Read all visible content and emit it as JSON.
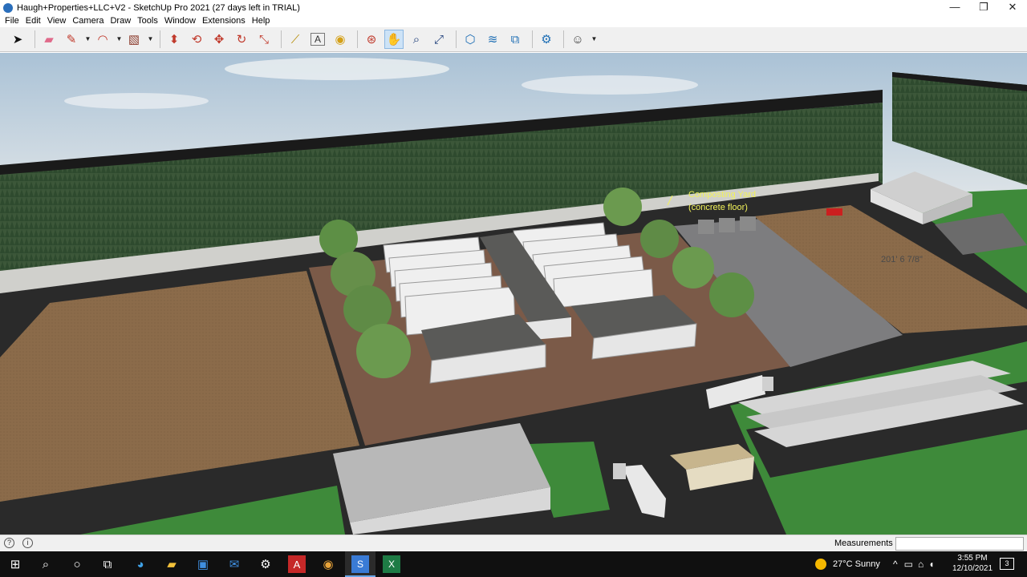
{
  "window": {
    "title": "Haugh+Properties+LLC+V2 - SketchUp Pro 2021 (27 days left in TRIAL)",
    "minimize": "—",
    "restore": "❐",
    "close": "✕"
  },
  "menu": [
    "File",
    "Edit",
    "View",
    "Camera",
    "Draw",
    "Tools",
    "Window",
    "Extensions",
    "Help"
  ],
  "toolbar": {
    "tools": [
      {
        "name": "select-tool",
        "icon": "arrow",
        "glyph": "➤"
      },
      {
        "name": "eraser-tool",
        "icon": "eraser",
        "glyph": "▰"
      },
      {
        "name": "line-tool",
        "icon": "pencil",
        "glyph": "✎"
      },
      {
        "name": "arc-tool",
        "icon": "arc",
        "glyph": "◠"
      },
      {
        "name": "shape-tool",
        "icon": "rectangle",
        "glyph": "▧"
      },
      {
        "name": "push-pull-tool",
        "icon": "push-pull",
        "glyph": "⬍"
      },
      {
        "name": "offset-tool",
        "icon": "offset",
        "glyph": "⟲"
      },
      {
        "name": "move-tool",
        "icon": "move",
        "glyph": "✥"
      },
      {
        "name": "rotate-tool",
        "icon": "rotate",
        "glyph": "↻"
      },
      {
        "name": "scale-tool",
        "icon": "scale",
        "glyph": "⤡"
      },
      {
        "name": "tape-measure-tool",
        "icon": "tape-measure",
        "glyph": "⟋"
      },
      {
        "name": "text-tool",
        "icon": "text",
        "glyph": "A"
      },
      {
        "name": "paint-bucket-tool",
        "icon": "paint-bucket",
        "glyph": "◉"
      },
      {
        "name": "orbit-tool",
        "icon": "orbit",
        "glyph": "⊛"
      },
      {
        "name": "pan-tool",
        "icon": "hand",
        "glyph": "✋"
      },
      {
        "name": "zoom-tool",
        "icon": "magnifier",
        "glyph": "⌕"
      },
      {
        "name": "zoom-extents-tool",
        "icon": "zoom-extents",
        "glyph": "⤢"
      },
      {
        "name": "warehouse-tool",
        "icon": "3d-warehouse",
        "glyph": "⬡"
      },
      {
        "name": "extension-warehouse-tool",
        "icon": "extension-warehouse",
        "glyph": "≋"
      },
      {
        "name": "layout-tool",
        "icon": "layout",
        "glyph": "⧉"
      },
      {
        "name": "extension-manager-tool",
        "icon": "extension-manager",
        "glyph": "⚙"
      },
      {
        "name": "account-tool",
        "icon": "user",
        "glyph": "☺"
      }
    ]
  },
  "scene": {
    "annotation_line1": "Composting Yard",
    "annotation_line2": "(concrete floor)",
    "dimension": "201' 6 7/8\"",
    "colors": {
      "sky": "#c4d2dd",
      "forest": "#3f5a3c",
      "soil": "#8a6a48",
      "brick": "#7b5a48",
      "road": "#2a2a2a",
      "concrete": "#7d7d7f",
      "grass": "#3e8a3a",
      "building": "#e6e6e6",
      "roof": "#5a5a58",
      "annotation": "#f2f25a"
    }
  },
  "status": {
    "measurements_label": "Measurements",
    "measurements_value": ""
  },
  "taskbar": {
    "weather": "27°C  Sunny",
    "time": "3:55 PM",
    "date": "12/10/2021",
    "notification_count": "3"
  }
}
